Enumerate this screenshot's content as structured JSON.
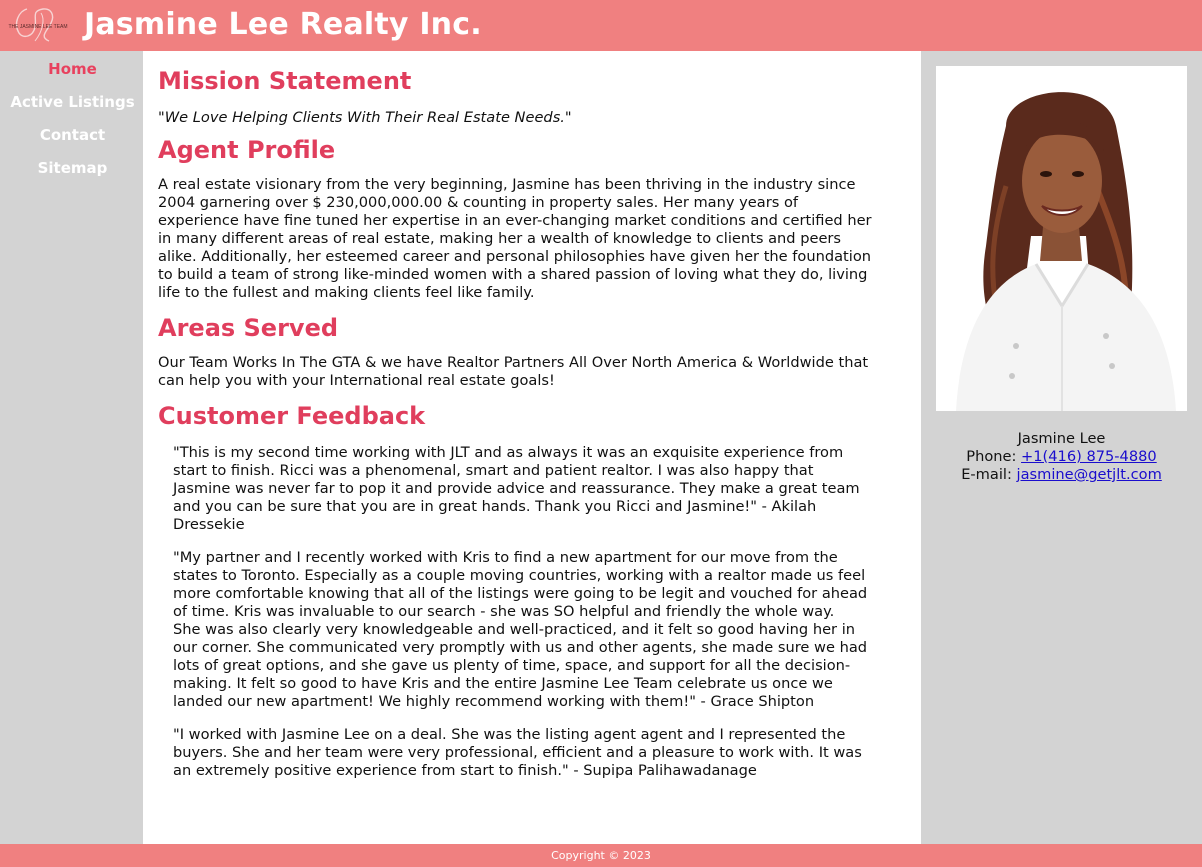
{
  "header": {
    "title": "Jasmine Lee Realty Inc.",
    "logo_text": "THE JASMINE LEE TEAM",
    "background": "#f08080"
  },
  "nav": {
    "items": [
      {
        "label": "Home",
        "active": true
      },
      {
        "label": "Active Listings",
        "active": false
      },
      {
        "label": "Contact",
        "active": false
      },
      {
        "label": "Sitemap",
        "active": false
      }
    ],
    "active_color": "#e8415e"
  },
  "main": {
    "mission": {
      "heading": "Mission Statement",
      "quote": "\"We Love Helping Clients With Their Real Estate Needs.\""
    },
    "profile": {
      "heading": "Agent Profile",
      "lines": [
        "A real estate visionary from the very beginning, Jasmine has been thriving in the industry since",
        "2004 garnering over $ 230,000,000.00 & counting in property sales. Her many years of",
        "experience have fine tuned her expertise in an ever-changing market conditions and certified her",
        "in many different areas of real estate, making her a wealth of knowledge to clients and peers",
        "alike. Additionally, her esteemed career and personal philosophies have given her the foundation",
        "to build a team of strong like-minded women with a shared passion of loving what they do, living",
        "life to the fullest and making clients feel like family."
      ]
    },
    "areas": {
      "heading": "Areas Served",
      "lines": [
        "Our Team Works In The GTA & we have Realtor Partners All Over North America & Worldwide that",
        "can help you with your International real estate goals!"
      ]
    },
    "feedback": {
      "heading": "Customer Feedback",
      "items": [
        {
          "lines": [
            "\"This is my second time working with JLT and as always it was an exquisite experience from",
            "start to finish. Ricci was a phenomenal, smart and patient realtor. I was also happy that",
            "Jasmine was never far to pop it and provide advice and reassurance. They make a great team",
            "and you can be sure that you are in great hands. Thank you Ricci and Jasmine!\" - Akilah",
            "Dressekie"
          ]
        },
        {
          "lines": [
            "\"My partner and I recently worked with Kris to find a new apartment for our move from the",
            "states to Toronto. Especially as a couple moving countries, working with a realtor made us feel",
            "more comfortable knowing that all of the listings were going to be legit and vouched for ahead",
            "of time. Kris was invaluable to our search - she was SO helpful and friendly the whole way.",
            "She was also clearly very knowledgeable and well-practiced, and it felt so good having her in",
            "our corner. She communicated very promptly with us and other agents, she made sure we had",
            "lots of great options, and she gave us plenty of time, space, and support for all the decision-",
            "making. It felt so good to have Kris and the entire Jasmine Lee Team celebrate us once we",
            "landed our new apartment! We highly recommend working with them!\" - Grace Shipton"
          ]
        },
        {
          "lines": [
            "\"I worked with Jasmine Lee on a deal. She was the listing agent agent and I represented the",
            "buyers. She and her team were very professional, efficient and a pleasure to work with. It was",
            "an extremely positive experience from start to finish.\" - Supipa Palihawadanage"
          ]
        }
      ]
    }
  },
  "sidebar": {
    "name": "Jasmine Lee",
    "phone_label": "Phone:",
    "phone": "+1(416) 875-4880",
    "email_label": "E-mail:",
    "email": "jasmine@getjlt.com"
  },
  "footer": {
    "text": "Copyright © 2023"
  },
  "colors": {
    "accent": "#e03e5d",
    "header_bg": "#f08080",
    "page_bg": "#d3d3d3",
    "link": "#1a0dcd"
  }
}
